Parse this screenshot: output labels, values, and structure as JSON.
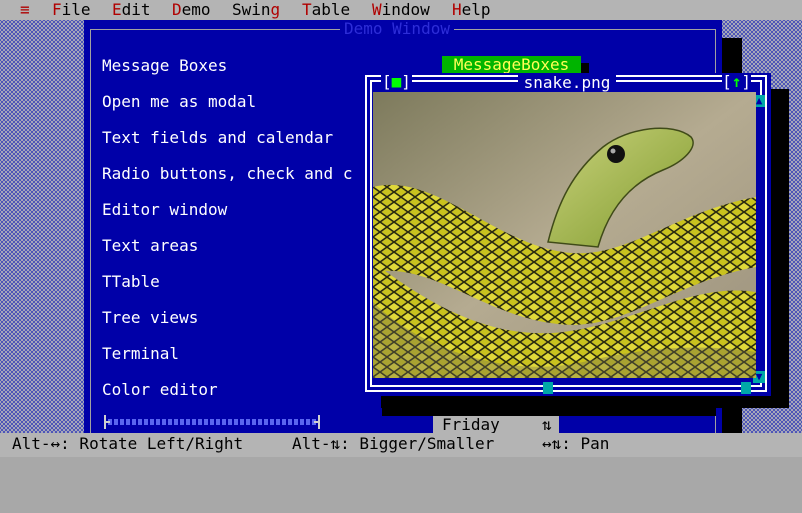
{
  "menubar": {
    "system_icon": "≡",
    "items": [
      {
        "hot": "F",
        "rest": "ile"
      },
      {
        "hot": "E",
        "rest": "dit"
      },
      {
        "hot": "D",
        "rest": "emo"
      },
      {
        "pre": "Swin",
        "hot": "g",
        "rest": ""
      },
      {
        "hot": "T",
        "rest": "able"
      },
      {
        "hot": "W",
        "rest": "indow"
      },
      {
        "hot": "H",
        "rest": "elp"
      }
    ]
  },
  "demo_window": {
    "title": "Demo Window",
    "items": [
      "Message Boxes",
      "Open me as modal",
      "Text fields and calendar",
      "Radio buttons, check and c",
      "Editor window",
      "Text areas",
      "TTable",
      "Tree views",
      "Terminal",
      "Color editor"
    ],
    "button_label": "MessageBoxes"
  },
  "image_window": {
    "title": "snake.png",
    "close_glyph": "■",
    "zoom_glyph": "↑",
    "scroll_up": "▲",
    "scroll_down": "▼"
  },
  "bottom_field": {
    "text": "Friday",
    "arrows": "⇅"
  },
  "statusbar": {
    "hint1": "Alt-↔: Rotate Left/Right",
    "hint2": "Alt-⇅: Bigger/Smaller",
    "hint3": "↔⇅: Pan"
  }
}
